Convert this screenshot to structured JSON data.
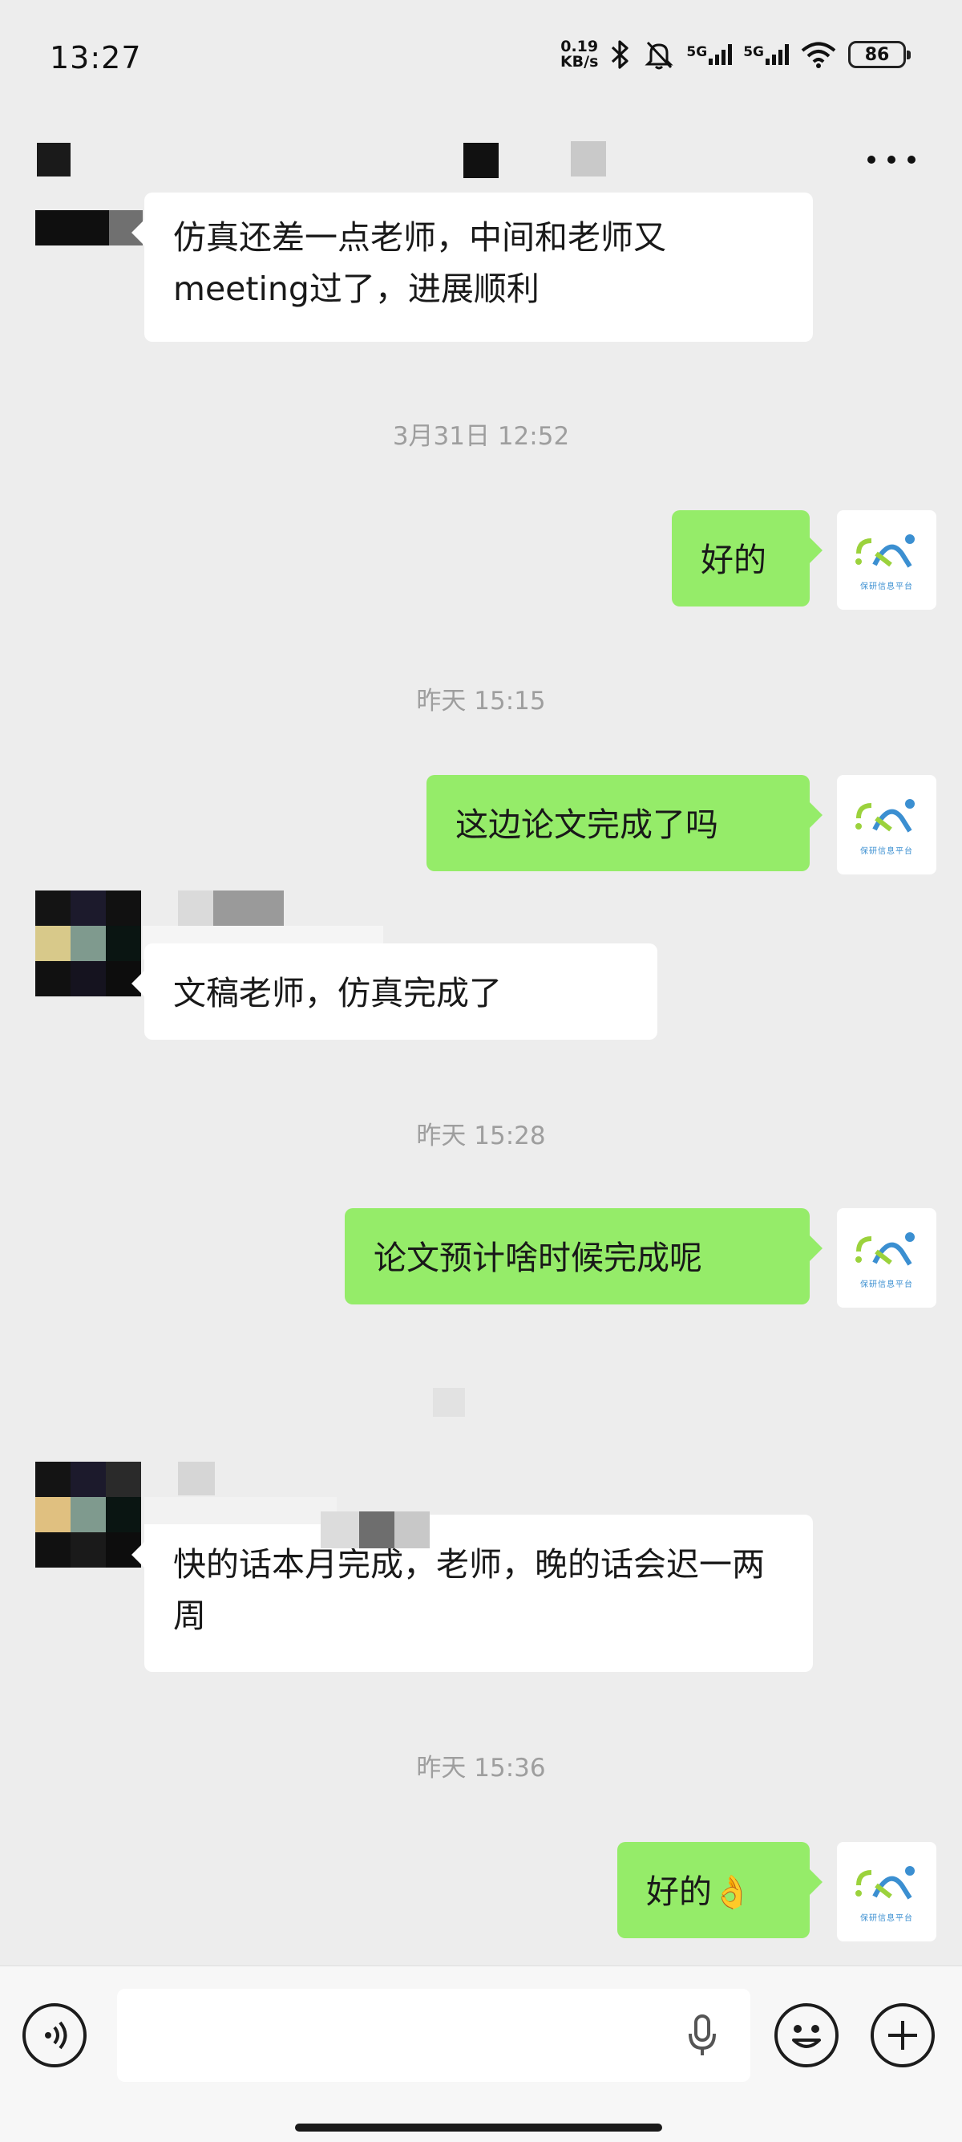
{
  "status_bar": {
    "time": "13:27",
    "net_speed_value": "0.19",
    "net_speed_unit": "KB/s",
    "sim1_label": "5G",
    "sim2_label": "5G",
    "battery_level": "86"
  },
  "header": {
    "title_redacted": true
  },
  "messages": [
    {
      "type": "incoming",
      "text": "仿真还差一点老师，中间和老师又meeting过了，进展顺利",
      "sender_redacted": true
    },
    {
      "type": "timestamp",
      "text": "3月31日 12:52"
    },
    {
      "type": "outgoing",
      "text": "好的"
    },
    {
      "type": "timestamp",
      "text": "昨天 15:15"
    },
    {
      "type": "outgoing",
      "text": "这边论文完成了吗"
    },
    {
      "type": "incoming",
      "text": "文稿老师，仿真完成了",
      "sender_redacted": true
    },
    {
      "type": "timestamp",
      "text": "昨天 15:28"
    },
    {
      "type": "outgoing",
      "text": "论文预计啥时候完成呢"
    },
    {
      "type": "incoming",
      "text": "快的话本月完成，老师，晚的话会迟一两周",
      "sender_redacted": true
    },
    {
      "type": "timestamp",
      "text": "昨天 15:36"
    },
    {
      "type": "outgoing",
      "text": "好的",
      "emoji": "👌"
    }
  ],
  "self_avatar": {
    "logo_text": "保研信息平台",
    "colors": {
      "green": "#9bd23c",
      "blue": "#3b8fd1"
    }
  },
  "input_bar": {
    "placeholder": "",
    "icons": [
      "voice-icon",
      "mic-icon",
      "emoji-icon",
      "add-icon"
    ]
  },
  "colors": {
    "background": "#ededed",
    "outgoing_bubble": "#95ec69",
    "incoming_bubble": "#ffffff",
    "timestamp_text": "#9e9e9e"
  }
}
